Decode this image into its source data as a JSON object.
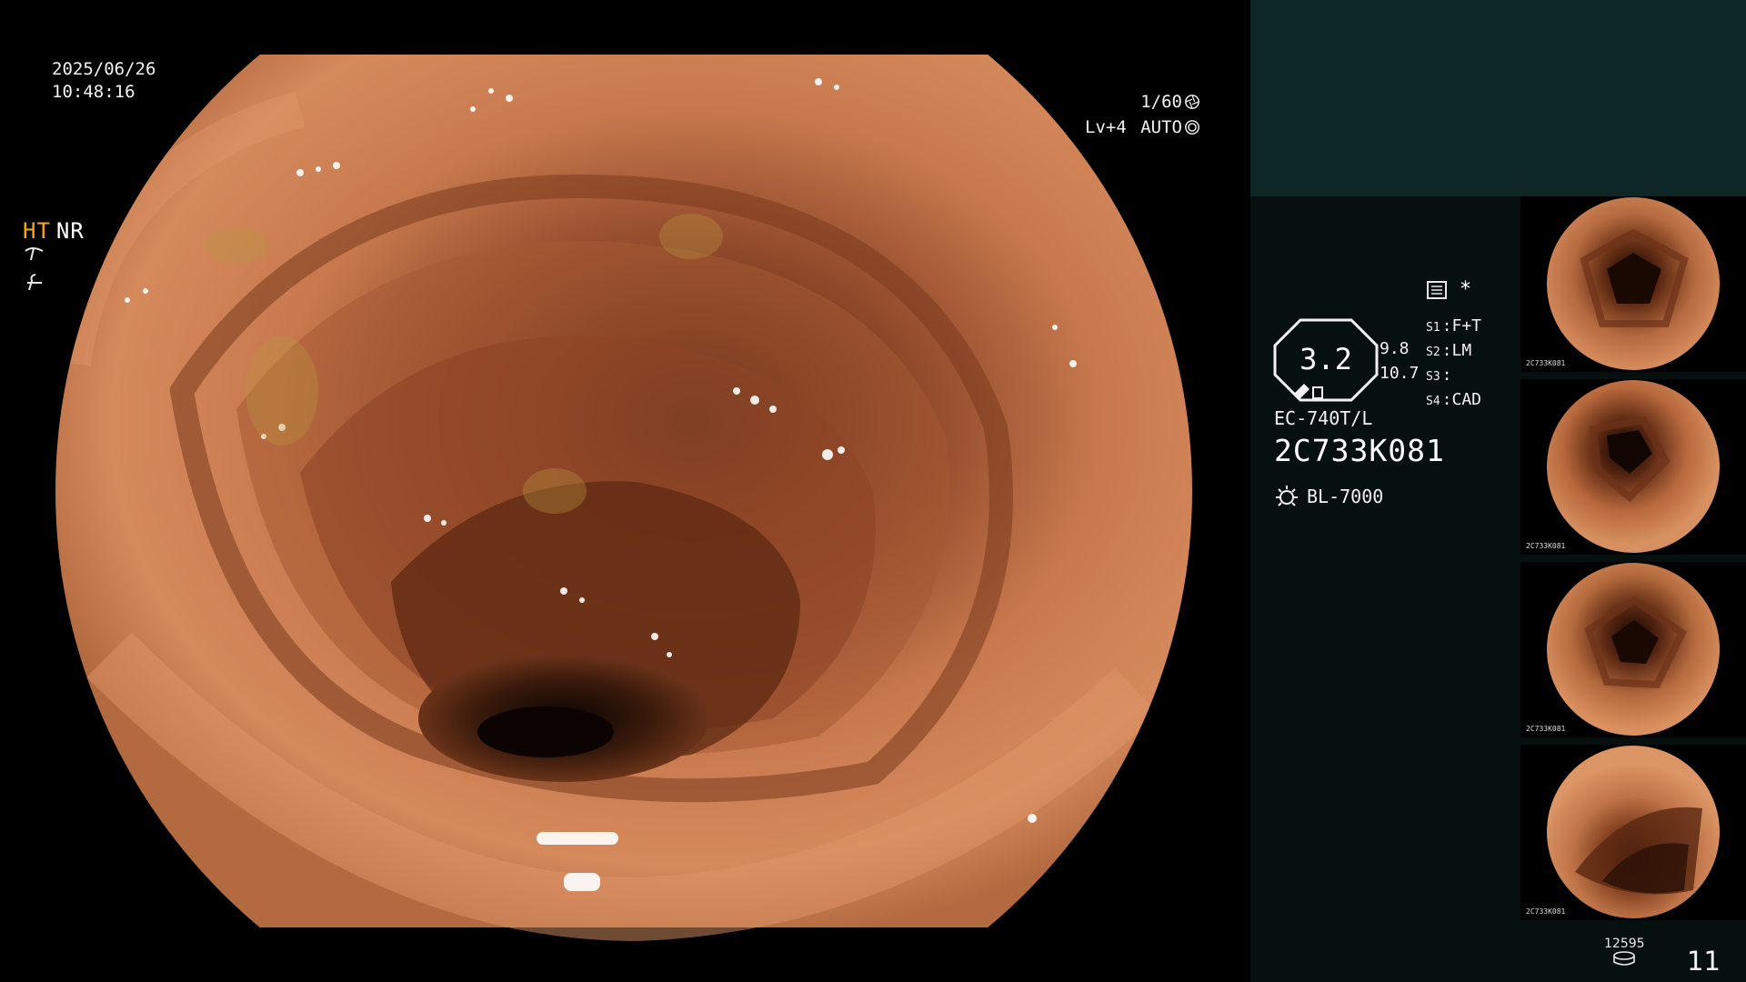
{
  "overlay": {
    "date": "2025/06/26",
    "time": "10:48:16",
    "shutter": "1/60",
    "level": "Lv+4",
    "iris_mode": "AUTO"
  },
  "panel": {
    "mode_ht": "HT",
    "mode_nr": "NR",
    "gauge_value": "3.2",
    "sub_value_1": "9.8",
    "sub_value_2": "10.7",
    "switches": [
      {
        "key": "S1",
        "value": "F+T"
      },
      {
        "key": "S2",
        "value": "LM"
      },
      {
        "key": "S3",
        "value": ""
      },
      {
        "key": "S4",
        "value": "CAD"
      }
    ],
    "scope_model": "EC-740T/L",
    "scope_serial": "2C733K081",
    "light_source": "BL-7000",
    "asterisk": "*"
  },
  "thumbnails": [
    {
      "label": "2C733K081"
    },
    {
      "label": "2C733K081"
    },
    {
      "label": "2C733K081"
    },
    {
      "label": "2C733K081"
    }
  ],
  "storage": {
    "remaining": "12595",
    "capture_count": "11"
  },
  "colors": {
    "accent_ht": "#f5a523",
    "panel_bg": "#06100f",
    "panel_top": "#0d2727"
  }
}
